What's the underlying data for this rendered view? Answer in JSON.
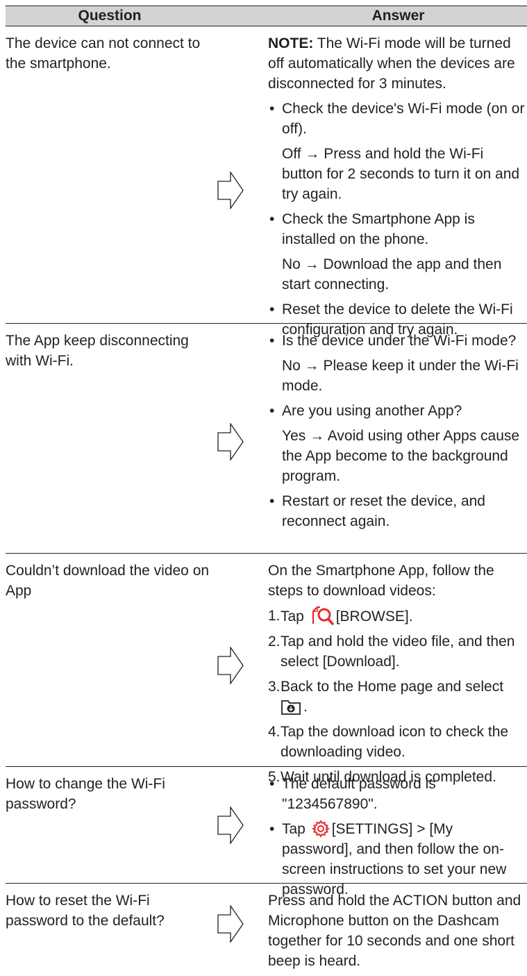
{
  "header": {
    "question": "Question",
    "answer": "Answer"
  },
  "rows": [
    {
      "question": "The device can not connect to the smartphone.",
      "note_label": "NOTE:",
      "note_text": " The Wi-Fi mode will be turned off automatically when the devices are disconnected for 3 minutes.",
      "items": [
        {
          "text": "Check the device's Wi-Fi mode (on or off).",
          "sub": "Off → Press and hold the Wi-Fi button for 2 seconds to turn it on and try again."
        },
        {
          "text": "Check the Smartphone App is installed on the phone.",
          "sub": "No → Download the app and then start connecting."
        },
        {
          "text": "Reset the device to delete the Wi-Fi configuration and try again."
        }
      ]
    },
    {
      "question": "The App keep disconnecting with Wi-Fi.",
      "items": [
        {
          "text": "Is the device under the Wi-Fi mode?",
          "sub": "No → Please keep it under the Wi-Fi mode."
        },
        {
          "text": "Are you using another App?",
          "sub": "Yes → Avoid using other Apps cause the App become to the background program."
        },
        {
          "text": "Restart or reset the device, and reconnect again."
        }
      ]
    },
    {
      "question": "Couldn’t download the video on App",
      "intro": "On the Smartphone App, follow the steps to download videos:",
      "steps": [
        {
          "num": "1.",
          "pre": "Tap",
          "icon": "browse-icon",
          "post": "[BROWSE]."
        },
        {
          "num": "2.",
          "text": "Tap and hold the video file, and then select [Download]."
        },
        {
          "num": "3.",
          "text": "Back to the Home page and select",
          "icon": "download-folder-icon",
          "post": "."
        },
        {
          "num": "4.",
          "text": "Tap the download icon to check the downloading video."
        },
        {
          "num": "5.",
          "text": "Wait until download is completed."
        }
      ]
    },
    {
      "question": "How to change the Wi-Fi password?",
      "items": [
        {
          "text": "The default password is \"1234567890\"."
        },
        {
          "pre": "Tap",
          "icon": "settings-gear-icon",
          "post": "[SETTINGS] > [My password], and then follow the on-screen instructions to set your new password."
        }
      ]
    },
    {
      "question": "How to reset the Wi-Fi password to the default?",
      "text": "Press and hold the ACTION button and Microphone button on the Dashcam together for 10 seconds and one short beep is heard."
    }
  ],
  "colors": {
    "header_bg": "#d2d3d5",
    "text": "#231f20",
    "icon_red": "#e8282e"
  }
}
